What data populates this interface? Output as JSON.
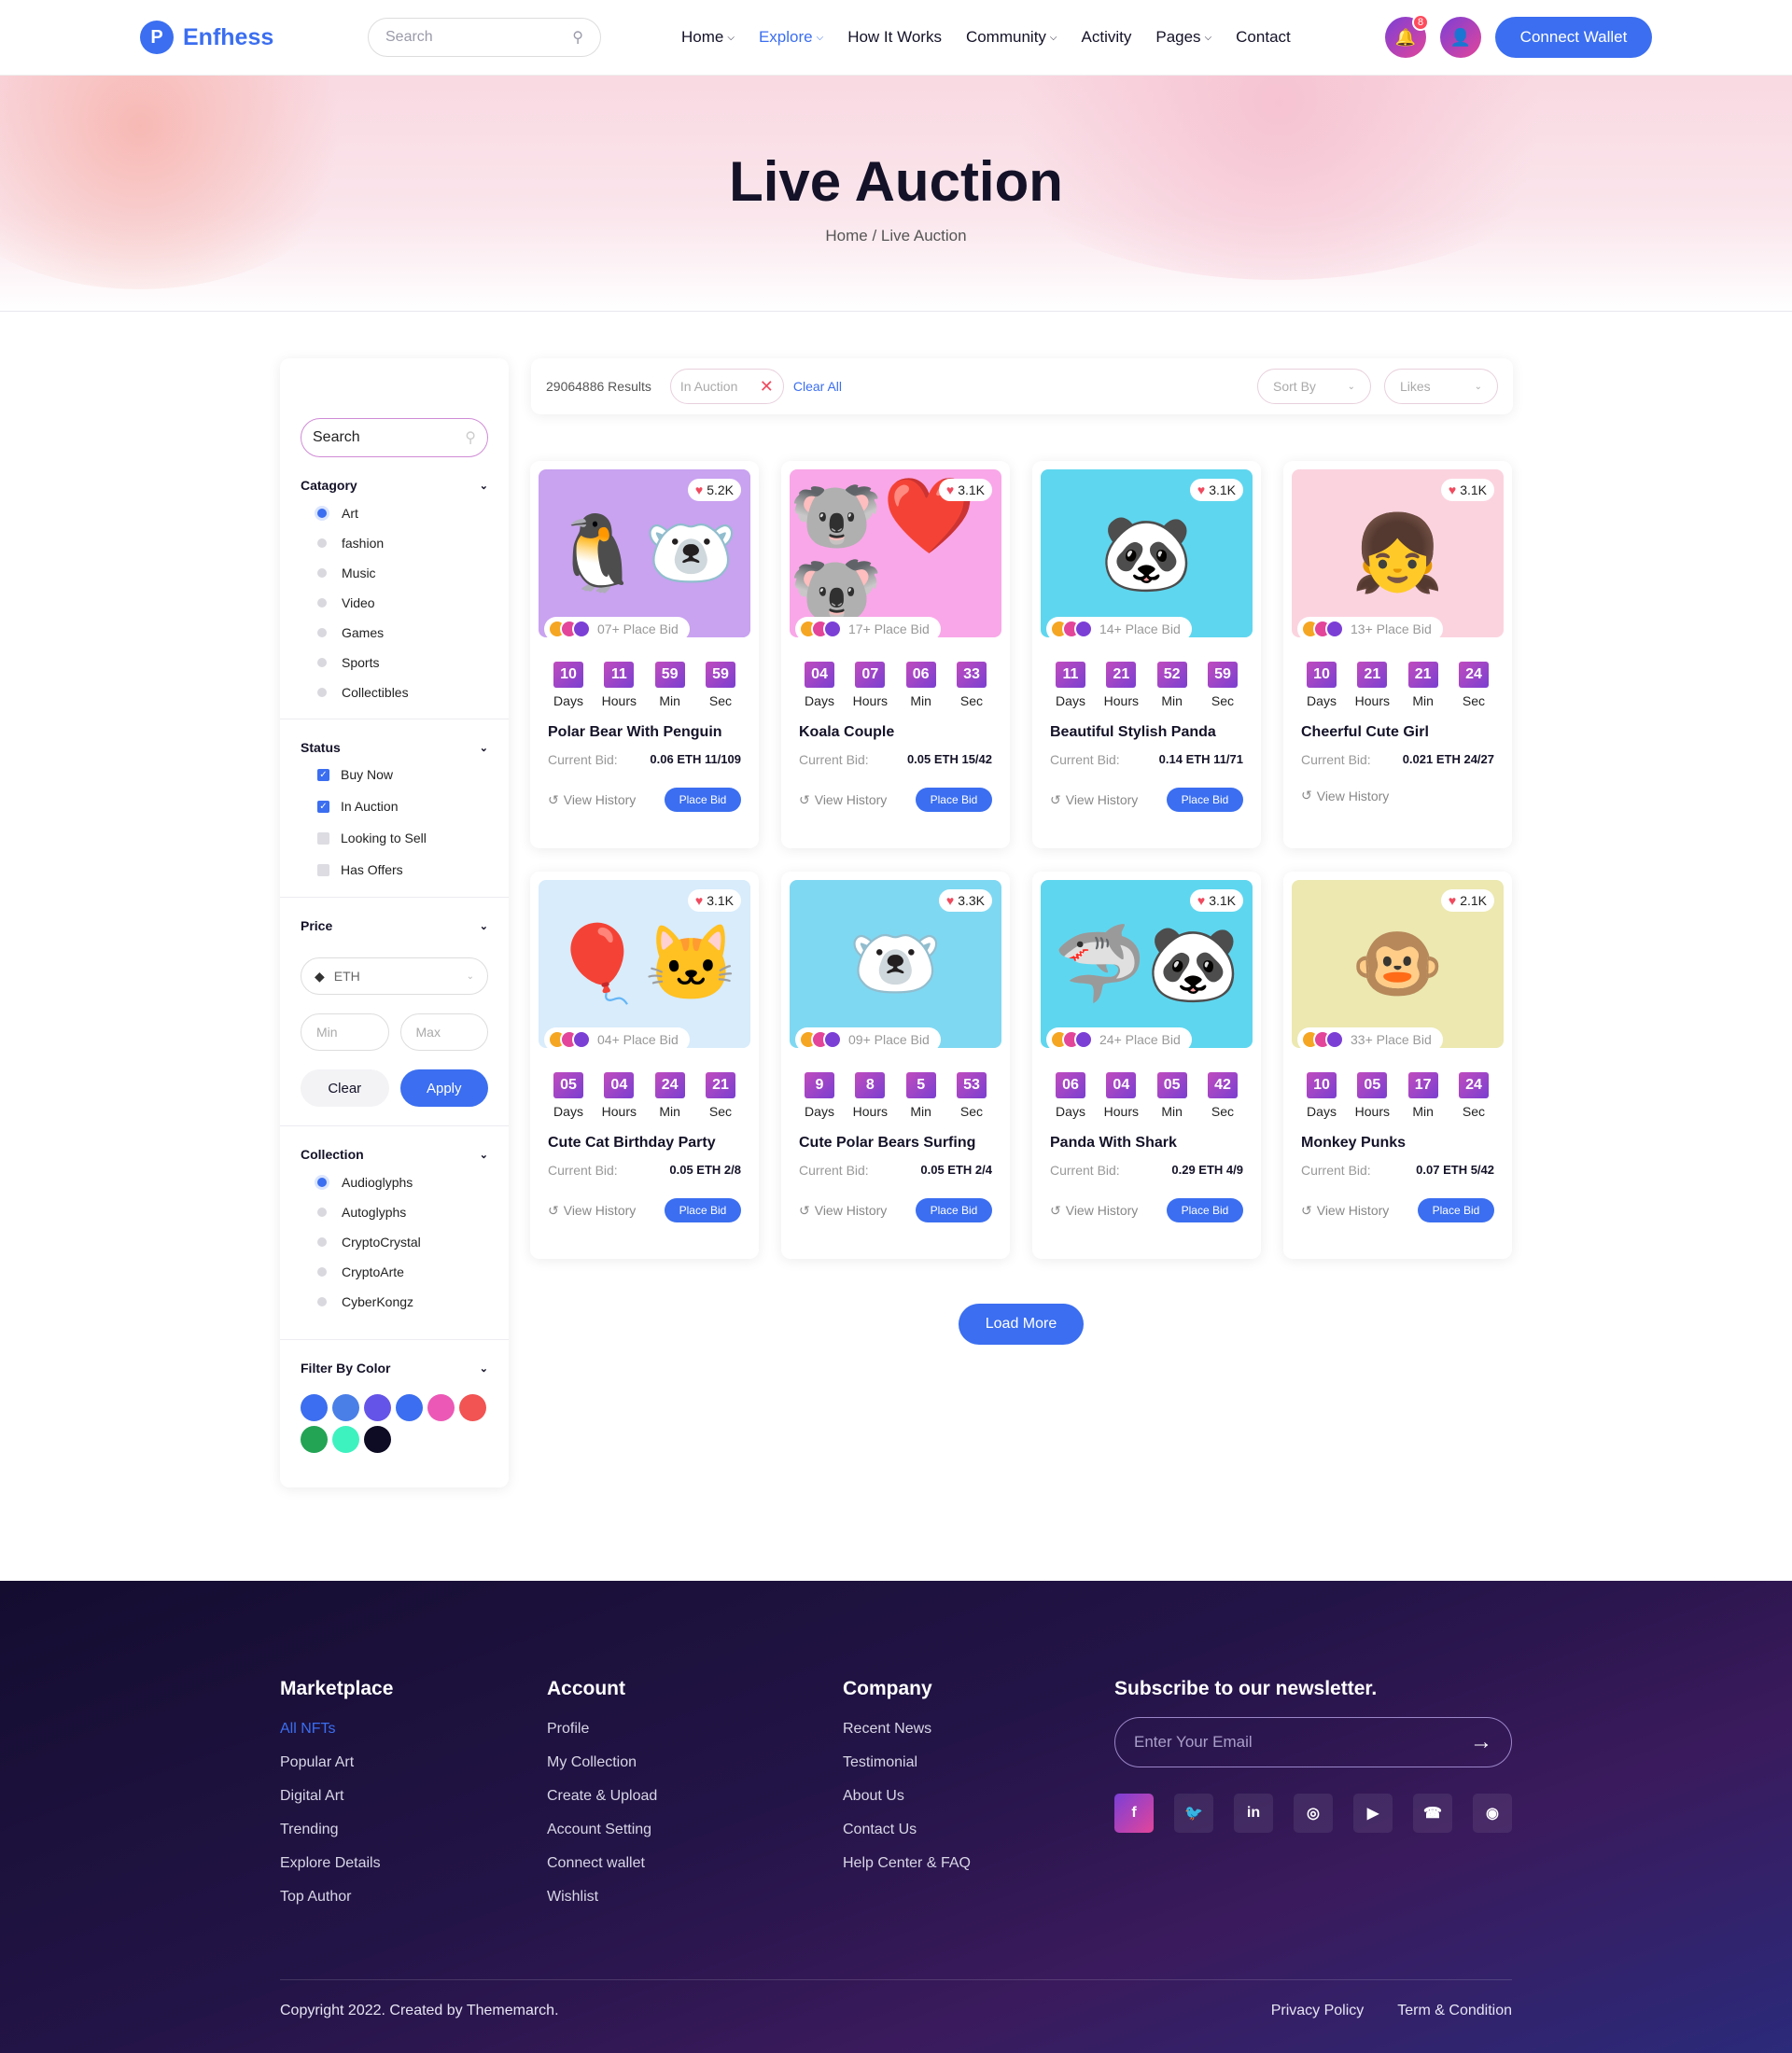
{
  "header": {
    "logo_mark": "P",
    "logo_text": "Enfhess",
    "search_placeholder": "Search",
    "nav": [
      {
        "label": "Home",
        "dropdown": true
      },
      {
        "label": "Explore",
        "dropdown": true,
        "active": true
      },
      {
        "label": "How It Works",
        "dropdown": false
      },
      {
        "label": "Community",
        "dropdown": true
      },
      {
        "label": "Activity",
        "dropdown": false
      },
      {
        "label": "Pages",
        "dropdown": true
      },
      {
        "label": "Contact",
        "dropdown": false
      }
    ],
    "notification_count": "8",
    "connect_label": "Connect Wallet"
  },
  "hero": {
    "title": "Live Auction",
    "breadcrumb": "Home / Live Auction"
  },
  "sidebar": {
    "search_placeholder": "Search",
    "category": {
      "title": "Catagory",
      "items": [
        {
          "label": "Art",
          "selected": true
        },
        {
          "label": "fashion",
          "selected": false
        },
        {
          "label": "Music",
          "selected": false
        },
        {
          "label": "Video",
          "selected": false
        },
        {
          "label": "Games",
          "selected": false
        },
        {
          "label": "Sports",
          "selected": false
        },
        {
          "label": "Collectibles",
          "selected": false
        }
      ]
    },
    "status": {
      "title": "Status",
      "items": [
        {
          "label": "Buy Now",
          "checked": true
        },
        {
          "label": "In Auction",
          "checked": true
        },
        {
          "label": "Looking to Sell",
          "checked": false
        },
        {
          "label": "Has Offers",
          "checked": false
        }
      ]
    },
    "price": {
      "title": "Price",
      "currency": "ETH",
      "min_placeholder": "Min",
      "max_placeholder": "Max",
      "clear_label": "Clear",
      "apply_label": "Apply"
    },
    "collection": {
      "title": "Collection",
      "items": [
        {
          "label": "Audioglyphs",
          "selected": true
        },
        {
          "label": "Autoglyphs",
          "selected": false
        },
        {
          "label": "CryptoCrystal",
          "selected": false
        },
        {
          "label": "CryptoArte",
          "selected": false
        },
        {
          "label": "CyberKongz",
          "selected": false
        }
      ]
    },
    "color_filter": {
      "title": "Filter By Color",
      "colors": [
        "#3b6ef0",
        "#4a7fe8",
        "#6554e8",
        "#3b6ef0",
        "#ec58b6",
        "#f25353",
        "#22a454",
        "#3ef2c0",
        "#0e0b24"
      ]
    }
  },
  "toolbar": {
    "results": "29064886 Results",
    "chip_label": "In Auction",
    "clear_all": "Clear All",
    "sort_by": "Sort By",
    "likes": "Likes"
  },
  "cards": [
    {
      "title": "Polar Bear With Penguin",
      "likes": "5.2K",
      "bids": "07+ Place Bid",
      "timer": [
        "10",
        "11",
        "59",
        "59"
      ],
      "bid_label": "Current Bid:",
      "bid_value": "0.06 ETH 11/109",
      "history": "View History",
      "place_bid": "Place Bid",
      "bg": "#c9a2f0",
      "art": "🐧🐻‍❄️"
    },
    {
      "title": "Koala Couple",
      "likes": "3.1K",
      "bids": "17+ Place Bid",
      "timer": [
        "04",
        "07",
        "06",
        "33"
      ],
      "bid_label": "Current Bid:",
      "bid_value": "0.05 ETH 15/42",
      "history": "View History",
      "place_bid": "Place Bid",
      "bg": "#f9a7e8",
      "art": "🐨❤️🐨"
    },
    {
      "title": "Beautiful Stylish Panda",
      "likes": "3.1K",
      "bids": "14+ Place Bid",
      "timer": [
        "11",
        "21",
        "52",
        "59"
      ],
      "bid_label": "Current Bid:",
      "bid_value": "0.14 ETH 11/71",
      "history": "View History",
      "place_bid": "Place Bid",
      "bg": "#5fd6ef",
      "art": "🐼"
    },
    {
      "title": "Cheerful Cute Girl",
      "likes": "3.1K",
      "bids": "13+ Place Bid",
      "timer": [
        "10",
        "21",
        "21",
        "24"
      ],
      "bid_label": "Current Bid:",
      "bid_value": "0.021 ETH 24/27",
      "history": "View History",
      "place_bid": "",
      "bg": "#fbd3df",
      "art": "👧"
    },
    {
      "title": "Cute Cat Birthday Party",
      "likes": "3.1K",
      "bids": "04+ Place Bid",
      "timer": [
        "05",
        "04",
        "24",
        "21"
      ],
      "bid_label": "Current Bid:",
      "bid_value": "0.05 ETH 2/8",
      "history": "View History",
      "place_bid": "Place Bid",
      "bg": "#d8ecfb",
      "art": "🎈🐱"
    },
    {
      "title": "Cute Polar Bears Surfing",
      "likes": "3.3K",
      "bids": "09+ Place Bid",
      "timer": [
        "9",
        "8",
        "5",
        "53"
      ],
      "bid_label": "Current Bid:",
      "bid_value": "0.05 ETH 2/4",
      "history": "View History",
      "place_bid": "Place Bid",
      "bg": "#7fd8f2",
      "art": "🐻‍❄️"
    },
    {
      "title": "Panda With Shark",
      "likes": "3.1K",
      "bids": "24+ Place Bid",
      "timer": [
        "06",
        "04",
        "05",
        "42"
      ],
      "bid_label": "Current Bid:",
      "bid_value": "0.29 ETH 4/9",
      "history": "View History",
      "place_bid": "Place Bid",
      "bg": "#5fd6ef",
      "art": "🦈🐼"
    },
    {
      "title": "Monkey Punks",
      "likes": "2.1K",
      "bids": "33+ Place Bid",
      "timer": [
        "10",
        "05",
        "17",
        "24"
      ],
      "bid_label": "Current Bid:",
      "bid_value": "0.07 ETH 5/42",
      "history": "View History",
      "place_bid": "Place Bid",
      "bg": "#ece8b0",
      "art": "🐵"
    }
  ],
  "timer_labels": [
    "Days",
    "Hours",
    "Min",
    "Sec"
  ],
  "load_more": "Load More",
  "footer": {
    "columns": [
      {
        "title": "Marketplace",
        "links": [
          "All NFTs",
          "Popular Art",
          "Digital Art",
          "Trending",
          "Explore Details",
          "Top Author"
        ]
      },
      {
        "title": "Account",
        "links": [
          "Profile",
          "My Collection",
          "Create & Upload",
          "Account Setting",
          "Connect wallet",
          "Wishlist"
        ]
      },
      {
        "title": "Company",
        "links": [
          "Recent News",
          "Testimonial",
          "About Us",
          "Contact Us",
          "Help Center & FAQ"
        ]
      }
    ],
    "newsletter_title": "Subscribe to our newsletter.",
    "email_placeholder": "Enter Your Email",
    "socials": [
      "facebook-icon",
      "twitter-icon",
      "linkedin-icon",
      "instagram-icon",
      "youtube-icon",
      "whatsapp-icon",
      "github-icon"
    ],
    "copyright": "Copyright 2022. Created by Thememarch.",
    "bottom_links": [
      "Privacy Policy",
      "Term & Condition"
    ]
  }
}
